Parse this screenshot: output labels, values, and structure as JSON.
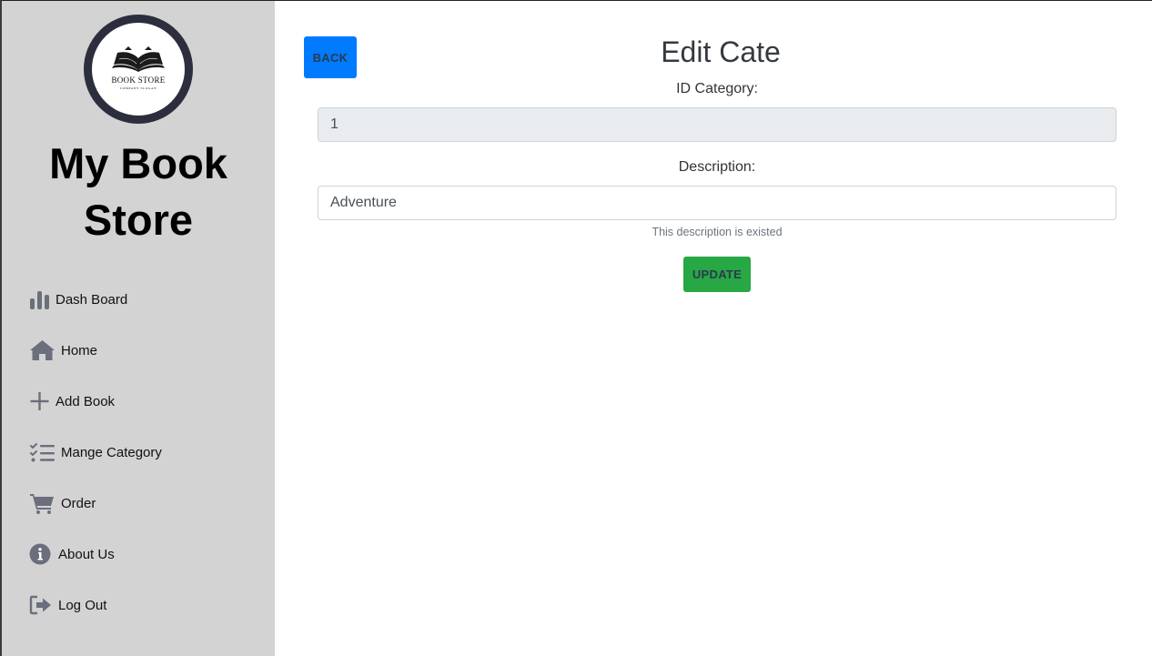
{
  "sidebar": {
    "logo": {
      "title": "BOOK STORE",
      "tagline": "COMPANY SLOGAN"
    },
    "brand": "My Book Store",
    "items": [
      {
        "label": "Dash Board",
        "icon": "bar-chart-icon"
      },
      {
        "label": "Home",
        "icon": "home-icon"
      },
      {
        "label": "Add Book",
        "icon": "plus-icon"
      },
      {
        "label": "Mange Category",
        "icon": "task-list-icon"
      },
      {
        "label": "Order",
        "icon": "cart-icon"
      },
      {
        "label": "About Us",
        "icon": "info-icon"
      },
      {
        "label": "Log Out",
        "icon": "logout-icon"
      }
    ],
    "icon_color": "#6b6e7d"
  },
  "main": {
    "back_label": "BACK",
    "title": "Edit Cate",
    "id_label": "ID Category:",
    "id_value": "1",
    "description_label": "Description:",
    "description_value": "Adventure",
    "description_help": "This description is existed",
    "update_label": "UPDATE"
  },
  "colors": {
    "sidebar_bg": "#d3d3d3",
    "primary": "#007bff",
    "success": "#28a745",
    "logo_ring": "#2c2e3e"
  }
}
